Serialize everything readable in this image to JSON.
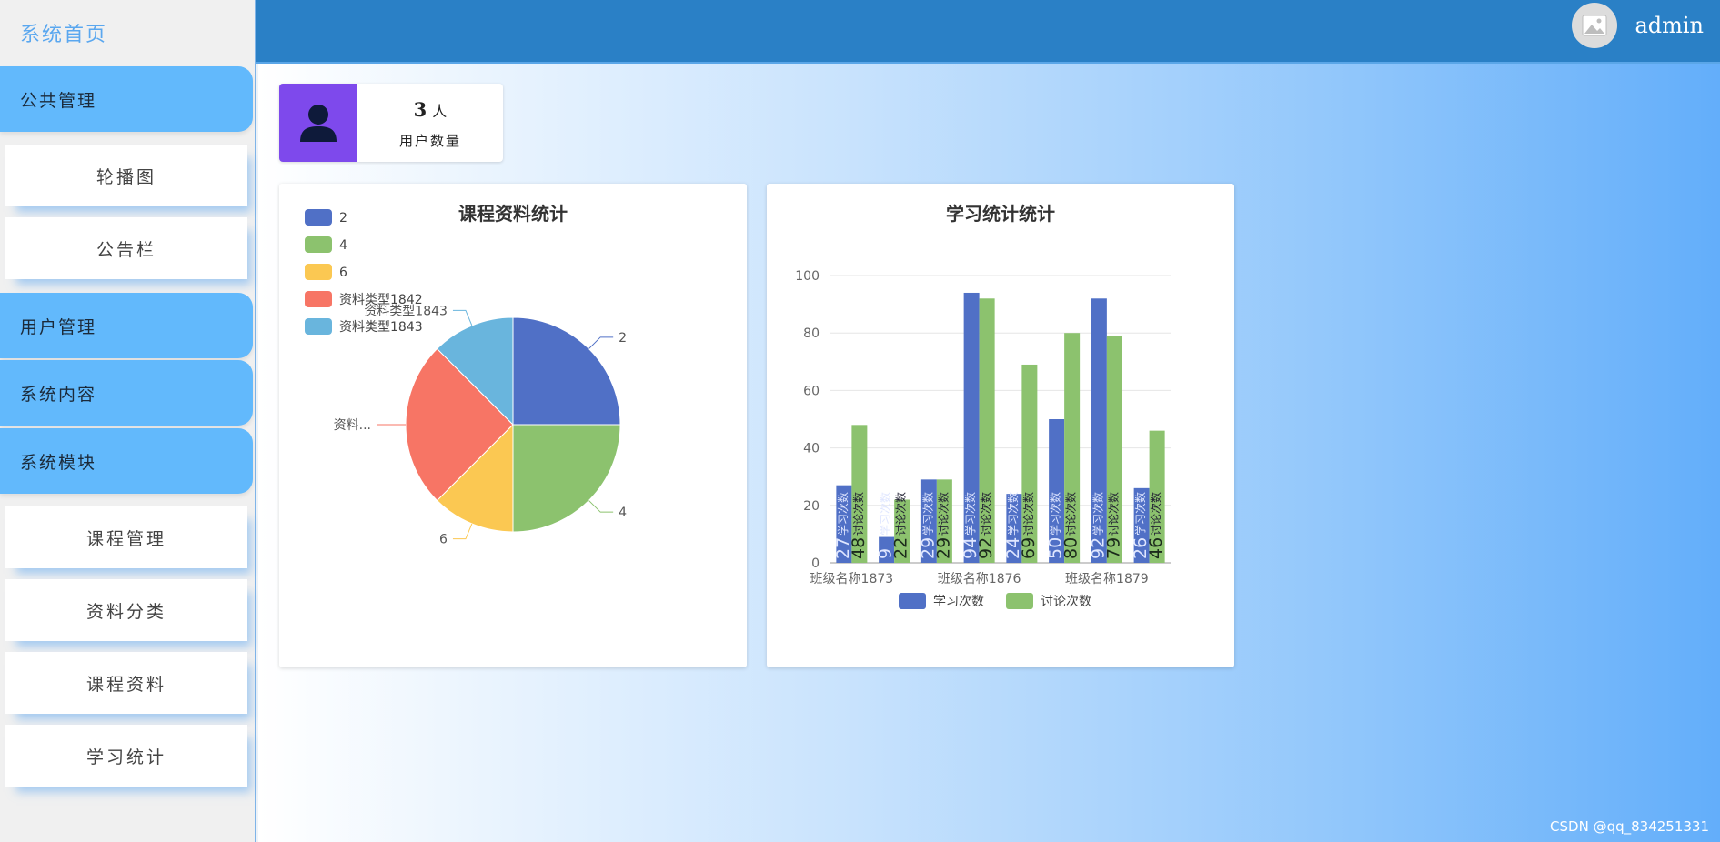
{
  "sidebar": {
    "home": "系统首页",
    "groups": [
      {
        "label": "公共管理",
        "items": [
          "轮播图",
          "公告栏"
        ]
      },
      {
        "label": "用户管理",
        "items": []
      },
      {
        "label": "系统内容",
        "items": []
      },
      {
        "label": "系统模块",
        "items": [
          "课程管理",
          "资料分类",
          "课程资料",
          "学习统计"
        ]
      }
    ]
  },
  "header": {
    "username": "admin",
    "avatar_icon": "image-icon",
    "color": "#2a80c6"
  },
  "stat_card": {
    "count": "3",
    "unit": "人",
    "label": "用户数量",
    "icon": "user-icon",
    "color": "#7e49ec"
  },
  "chart_data": [
    {
      "type": "pie",
      "title": "课程资料统计",
      "legend_position": "top-left",
      "slices": [
        {
          "name": "2",
          "value": 2,
          "label": "2",
          "color": "#5070c6"
        },
        {
          "name": "4",
          "value": 2,
          "label": "4",
          "color": "#8cc26e"
        },
        {
          "name": "6",
          "value": 1,
          "label": "6",
          "color": "#fbc852"
        },
        {
          "name": "资料类型1842",
          "value": 2,
          "label": "资料...",
          "color": "#f77565"
        },
        {
          "name": "资料类型1843",
          "value": 1,
          "label": "资料类型1843",
          "color": "#69b5dd"
        }
      ]
    },
    {
      "type": "bar",
      "title": "学习统计统计",
      "ylim": [
        0,
        100
      ],
      "yticks": [
        0,
        20,
        40,
        60,
        80,
        100
      ],
      "grid": true,
      "legend_position": "bottom",
      "categories": [
        "班级名称1873",
        "",
        "",
        "班级名称1876",
        "",
        "",
        "班级名称1879",
        ""
      ],
      "series": [
        {
          "name": "学习次数",
          "values": [
            27,
            9,
            29,
            94,
            24,
            50,
            92,
            26
          ],
          "color": "#5070c6",
          "bar_label": "学习次数"
        },
        {
          "name": "讨论次数",
          "values": [
            48,
            22,
            29,
            92,
            69,
            80,
            79,
            46
          ],
          "color": "#8cc26e",
          "bar_label": "讨论次数"
        }
      ]
    }
  ],
  "watermark": "CSDN @qq_834251331"
}
